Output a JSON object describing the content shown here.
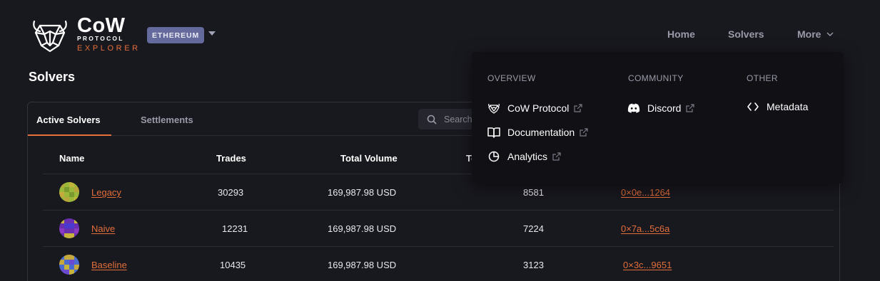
{
  "header": {
    "logo": {
      "line1": "CoW",
      "line2": "PROTOCOL",
      "line3": "EXPLORER"
    },
    "network_badge": "ETHEREUM",
    "nav": {
      "home": "Home",
      "solvers": "Solvers",
      "more": "More"
    }
  },
  "page_title": "Solvers",
  "tabs": [
    {
      "label": "Active Solvers",
      "active": true
    },
    {
      "label": "Settlements",
      "active": false
    }
  ],
  "search": {
    "placeholder": "Search"
  },
  "table": {
    "columns": [
      "Name",
      "Trades",
      "Total Volume",
      "To"
    ],
    "rows": [
      {
        "name": "Legacy",
        "trades": "30293",
        "volume": "169,987.98 USD",
        "extra": "8581",
        "address": "0×0e...1264"
      },
      {
        "name": "Naive",
        "trades": "12231",
        "volume": "169,987.98 USD",
        "extra": "7224",
        "address": "0×7a...5c6a"
      },
      {
        "name": "Baseline",
        "trades": "10435",
        "volume": "169,987.98 USD",
        "extra": "3123",
        "address": "0×3c...9651"
      }
    ]
  },
  "dropdown": {
    "overview": {
      "heading": "OVERVIEW",
      "items": [
        {
          "label": "CoW Protocol",
          "icon": "cow-icon",
          "external": true
        },
        {
          "label": "Documentation",
          "icon": "book-icon",
          "external": true
        },
        {
          "label": "Analytics",
          "icon": "pie-chart-icon",
          "external": true
        }
      ]
    },
    "community": {
      "heading": "COMMUNITY",
      "items": [
        {
          "label": "Discord",
          "icon": "discord-icon",
          "external": true
        }
      ]
    },
    "other": {
      "heading": "OTHER",
      "items": [
        {
          "label": "Metadata",
          "icon": "code-icon",
          "external": false
        }
      ]
    }
  },
  "colors": {
    "background": "#18181f",
    "accent": "#e46f3a",
    "badge": "#656a9c",
    "dropdown_bg": "#101015"
  }
}
